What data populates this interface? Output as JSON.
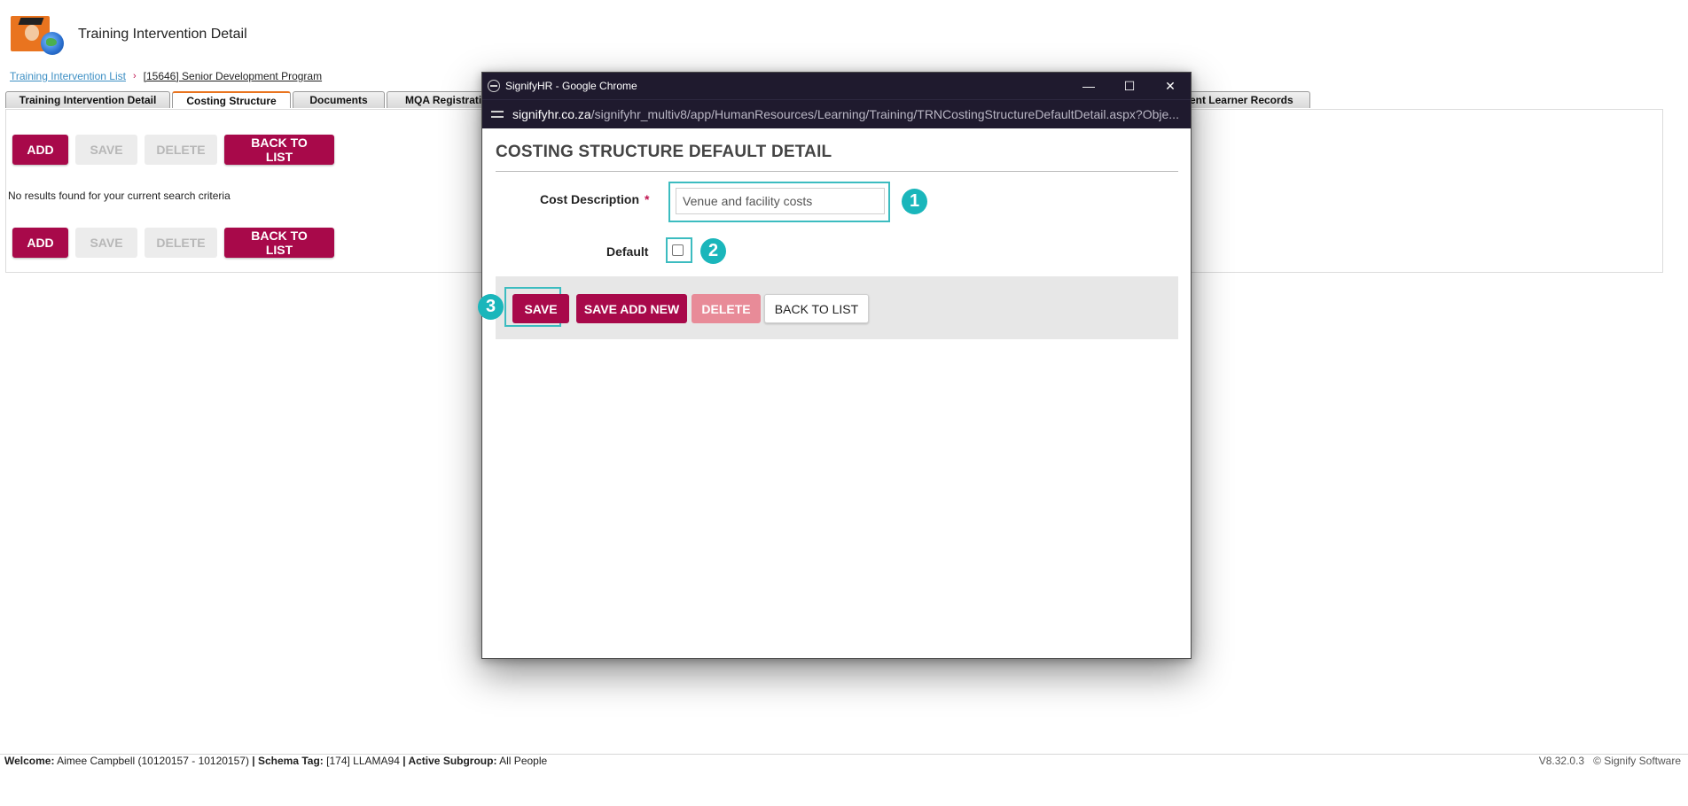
{
  "page": {
    "title": "Training Intervention Detail",
    "breadcrumb": {
      "list_link": "Training Intervention List",
      "separator": "›",
      "current": "[15646] Senior Development Program"
    },
    "tabs": [
      "Training Intervention Detail",
      "Costing Structure",
      "Documents",
      "MQA Registration"
    ],
    "tab_far": "vent Learner Records",
    "active_tab": "Costing Structure",
    "buttons": {
      "add": "ADD",
      "save": "SAVE",
      "delete": "DELETE",
      "back": "BACK TO LIST"
    },
    "no_results": "No results found for your current search criteria"
  },
  "footer": {
    "welcome_label": "Welcome:",
    "welcome_value": "Aimee Campbell (10120157 - 10120157)",
    "schema_label": "| Schema Tag:",
    "schema_value": "[174] LLAMA94",
    "subgroup_label": "| Active Subgroup:",
    "subgroup_value": "All People",
    "version": "V8.32.0.3",
    "copyright": "© Signify Software"
  },
  "popup": {
    "window_title": "SignifyHR - Google Chrome",
    "window_controls": {
      "minimize": "—",
      "maximize": "☐",
      "close": "✕"
    },
    "url_domain": "signifyhr.co.za",
    "url_path": "/signifyhr_multiv8/app/HumanResources/Learning/Training/TRNCostingStructureDefaultDetail.aspx?Obje...",
    "heading": "COSTING STRUCTURE DEFAULT DETAIL",
    "cost_description_label": "Cost Description",
    "required_marker": "*",
    "cost_description_value": "Venue and facility costs",
    "default_label": "Default",
    "default_checked": false,
    "buttons": {
      "save": "SAVE",
      "save_add_new": "SAVE ADD NEW",
      "delete": "DELETE",
      "back": "BACK TO LIST"
    },
    "badges": [
      "1",
      "2",
      "3"
    ]
  },
  "colors": {
    "brand": "#a8094a",
    "highlight": "#3cbcc0",
    "badge": "#1ab6bb",
    "titlebar": "#1f1a2e"
  }
}
